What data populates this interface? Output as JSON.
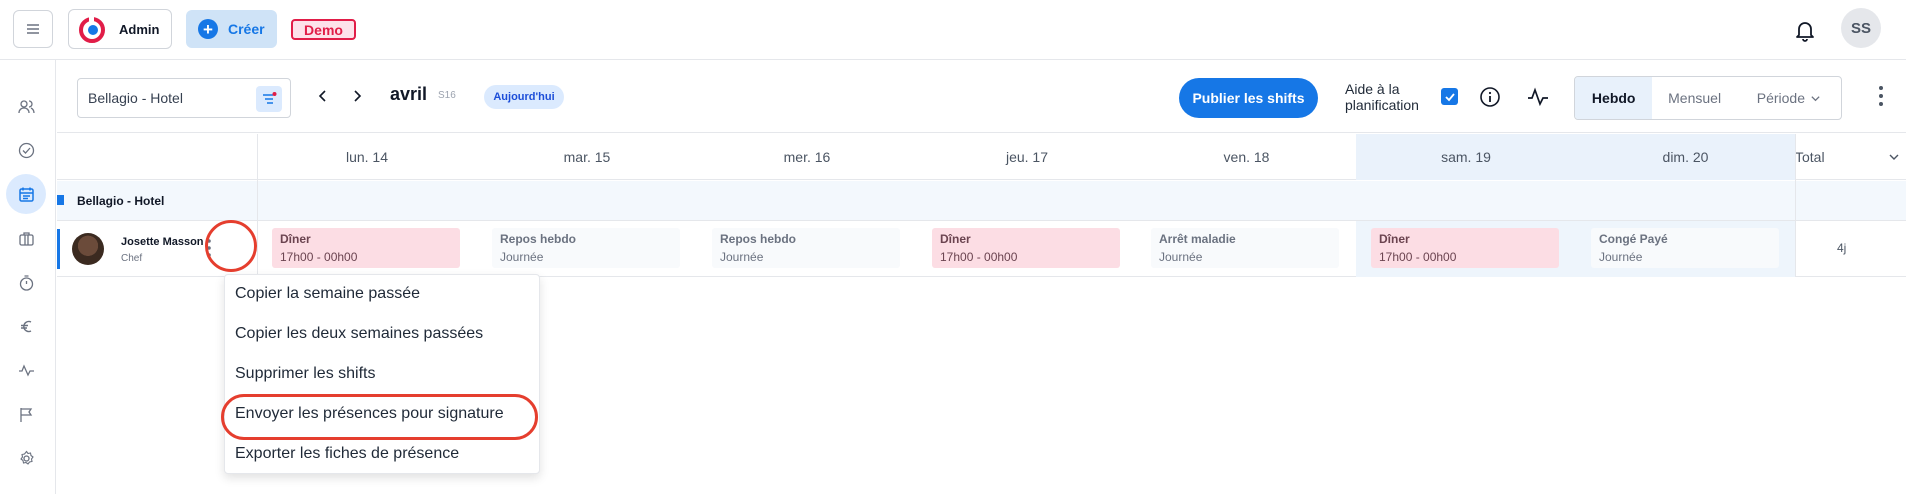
{
  "topbar": {
    "brand_label": "Admin",
    "create_label": "Créer",
    "demo_label": "Demo",
    "user_initials": "SS"
  },
  "toolbar": {
    "site": "Bellagio - Hotel",
    "month": "avril",
    "week": "S16",
    "today_label": "Aujourd'hui",
    "publish_label": "Publier les shifts",
    "planning_help_label": "Aide à la planification",
    "views": [
      "Hebdo",
      "Mensuel",
      "Période"
    ],
    "active_view": "Hebdo"
  },
  "grid": {
    "days": [
      "lun.  14",
      "mar.  15",
      "mer.  16",
      "jeu.  17",
      "ven.  18",
      "sam.  19",
      "dim.  20"
    ],
    "total_label": "Total",
    "group_name": "Bellagio - Hotel",
    "employee": {
      "name": "Josette Masson",
      "role": "Chef",
      "total": "4j",
      "shifts": [
        {
          "title": "Dîner",
          "sub": "17h00 - 00h00",
          "kind": "work"
        },
        {
          "title": "Repos hebdo",
          "sub": "Journée",
          "kind": "rest"
        },
        {
          "title": "Repos hebdo",
          "sub": "Journée",
          "kind": "rest"
        },
        {
          "title": "Dîner",
          "sub": "17h00 - 00h00",
          "kind": "work"
        },
        {
          "title": "Arrêt maladie",
          "sub": "Journée",
          "kind": "rest"
        },
        {
          "title": "Dîner",
          "sub": "17h00 - 00h00",
          "kind": "work"
        },
        {
          "title": "Congé Payé",
          "sub": "Journée",
          "kind": "rest"
        }
      ]
    }
  },
  "menu": {
    "items": [
      "Copier la semaine passée",
      "Copier les deux semaines passées",
      "Supprimer les shifts",
      "Envoyer les présences pour signature",
      "Exporter les fiches de présence"
    ]
  },
  "colors": {
    "accent": "#1677e6",
    "highlight": "#e53e2e",
    "work_shift": "#fcdde4"
  }
}
